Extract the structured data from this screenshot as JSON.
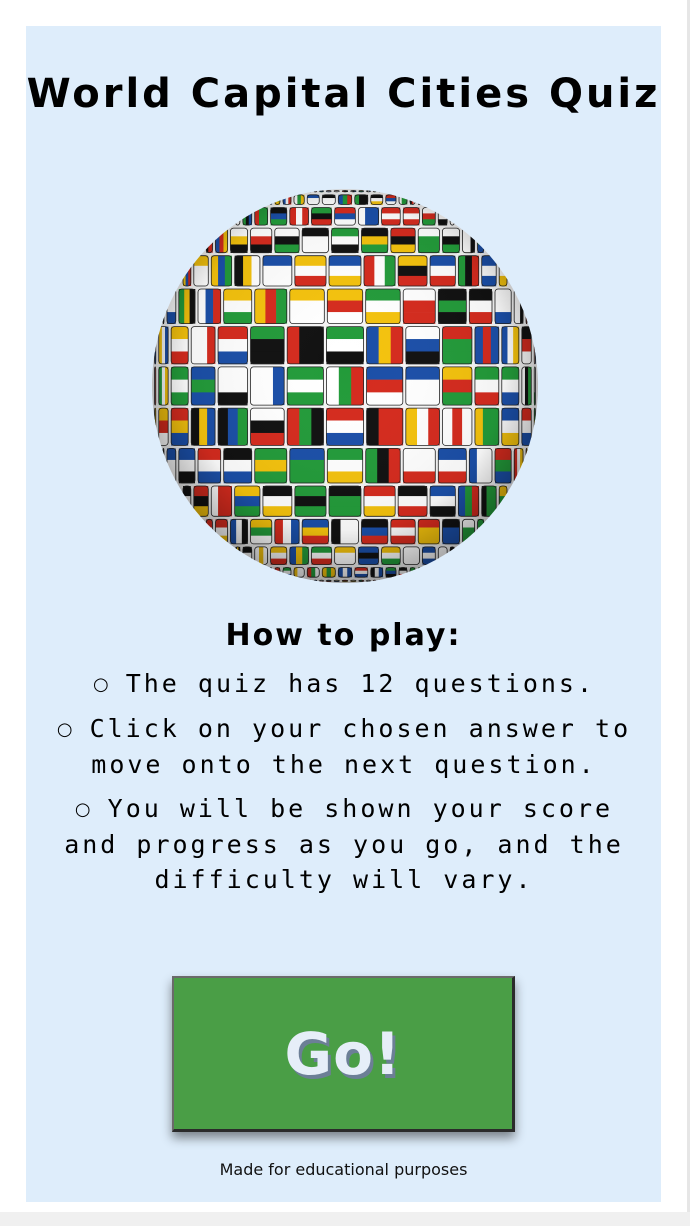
{
  "title": "World Capital Cities Quiz",
  "globe": {
    "icon": "flag-globe",
    "description_colors": [
      "#d52b1e",
      "#1b4fa8",
      "#ffffff",
      "#f4c20d",
      "#239b3a",
      "#111111"
    ]
  },
  "how_to_play": {
    "heading": "How to play:",
    "rules": [
      "The quiz has 12 questions.",
      "Click on your chosen answer to move onto the next question.",
      "You will be shown your score and progress as you go, and the difficulty will vary."
    ]
  },
  "start_button": {
    "label": "Go!"
  },
  "footer": "Made for educational purposes",
  "colors": {
    "card_background": "#deedfb",
    "button_green": "#4a9e46",
    "button_text": "#e6eef8"
  }
}
